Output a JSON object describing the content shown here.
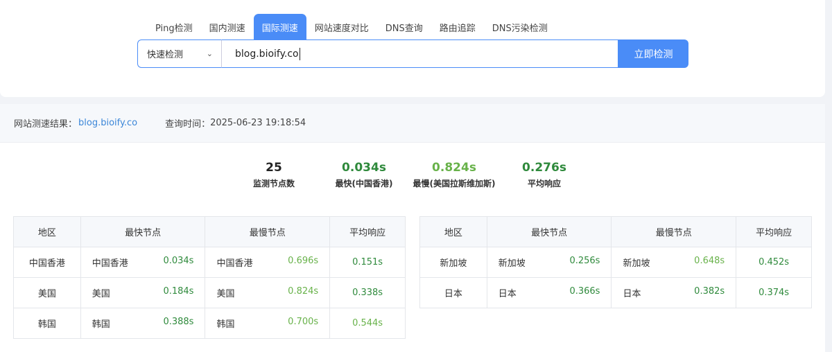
{
  "tabs": [
    "Ping检测",
    "国内测速",
    "国际测速",
    "网站速度对比",
    "DNS查询",
    "路由追踪",
    "DNS污染检测"
  ],
  "active_tab": 2,
  "search": {
    "mode": "快速检测",
    "value": "blog.bioify.co",
    "button": "立即检测"
  },
  "result": {
    "label": "网站测速结果：",
    "domain": "blog.bioify.co",
    "time_label": "查询时间：",
    "time": "2025-06-23 19:18:54"
  },
  "stats": [
    {
      "value": "25",
      "label": "监测节点数",
      "color": "#222222"
    },
    {
      "value": "0.034s",
      "label": "最快(中国香港)",
      "color": "#2f8a3c"
    },
    {
      "value": "0.824s",
      "label": "最慢(美国拉斯维加斯)",
      "color": "#68b24a"
    },
    {
      "value": "0.276s",
      "label": "平均响应",
      "color": "#2f8a3c"
    }
  ],
  "table_headers": [
    "地区",
    "最快节点",
    "最慢节点",
    "平均响应"
  ],
  "table_left": [
    {
      "region": "中国香港",
      "fast_node": "中国香港",
      "fast_time": "0.034s",
      "slow_node": "中国香港",
      "slow_time": "0.696s",
      "avg": "0.151s"
    },
    {
      "region": "美国",
      "fast_node": "美国",
      "fast_time": "0.184s",
      "slow_node": "美国",
      "slow_time": "0.824s",
      "avg": "0.338s"
    },
    {
      "region": "韩国",
      "fast_node": "韩国",
      "fast_time": "0.388s",
      "slow_node": "韩国",
      "slow_time": "0.700s",
      "avg": "0.544s"
    }
  ],
  "table_right": [
    {
      "region": "新加坡",
      "fast_node": "新加坡",
      "fast_time": "0.256s",
      "slow_node": "新加坡",
      "slow_time": "0.648s",
      "avg": "0.452s"
    },
    {
      "region": "日本",
      "fast_node": "日本",
      "fast_time": "0.366s",
      "slow_node": "日本",
      "slow_time": "0.382s",
      "avg": "0.374s"
    }
  ],
  "colors": {
    "accent": "#4a8cf7",
    "dark_green": "#2f8a3c",
    "light_green": "#68b24a",
    "link": "#3b86d8"
  }
}
